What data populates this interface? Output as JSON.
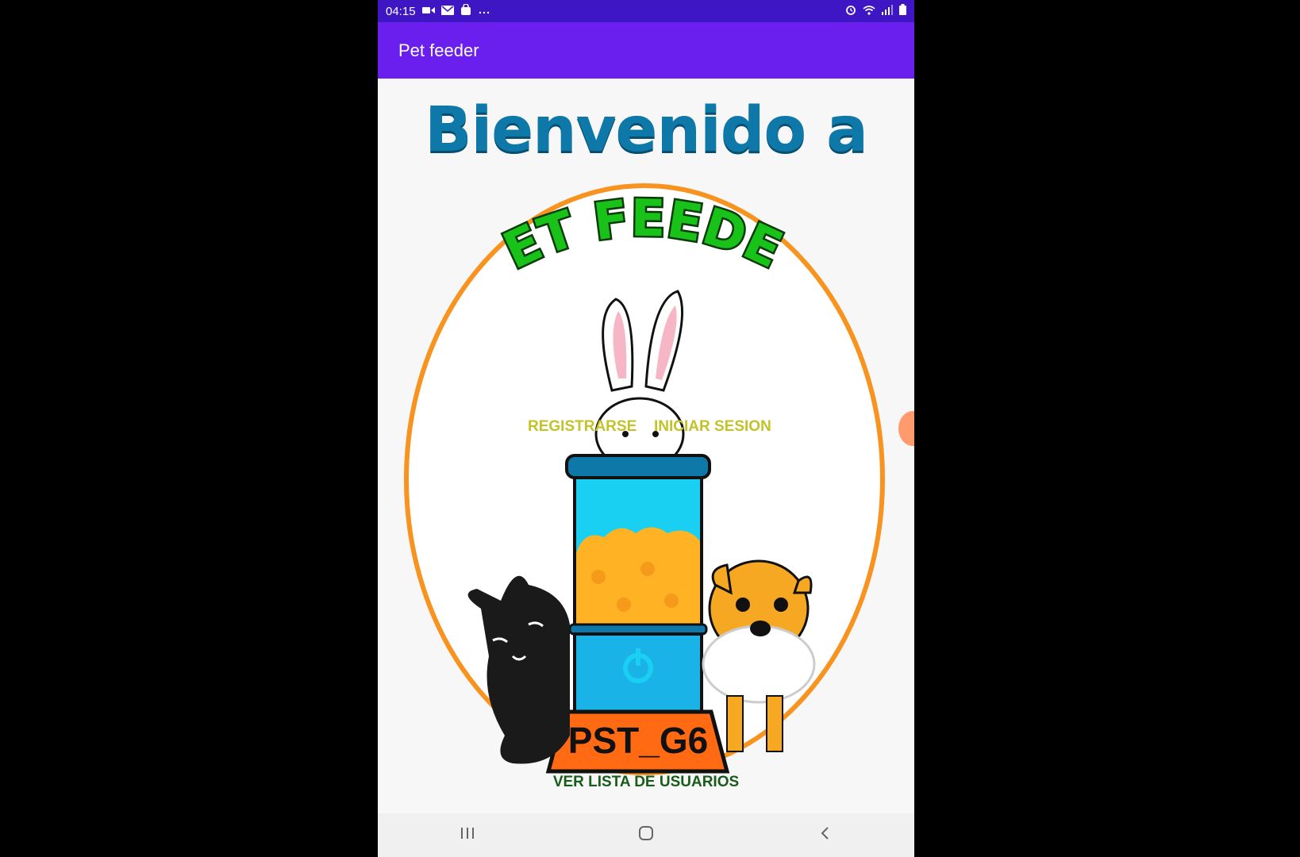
{
  "status_bar": {
    "time": "04:15",
    "left_icons": [
      "video-icon",
      "mail-icon",
      "bag-icon",
      "more-dots-icon"
    ],
    "right_icons": [
      "alarm-icon",
      "wifi-icon",
      "signal-icon",
      "battery-icon"
    ]
  },
  "app_bar": {
    "title": "Pet feeder"
  },
  "main": {
    "welcome_text": "Bienvenido a",
    "logo": {
      "brand_text": "PET FEEDER",
      "base_label": "PST_G6"
    },
    "buttons": {
      "register": "REGISTRARSE",
      "login": "INICIAR SESION",
      "users_list": "VER LISTA DE USUARIOS"
    }
  },
  "colors": {
    "status_bar": "#3e16c4",
    "app_bar": "#6a1fef",
    "welcome_text": "#0e78a8",
    "button_text": "#c3c229",
    "users_button_text": "#195c1a",
    "logo_ring": "#f7931e"
  },
  "nav_bar": {
    "icons": [
      "recent-apps-icon",
      "home-icon",
      "back-icon"
    ]
  }
}
